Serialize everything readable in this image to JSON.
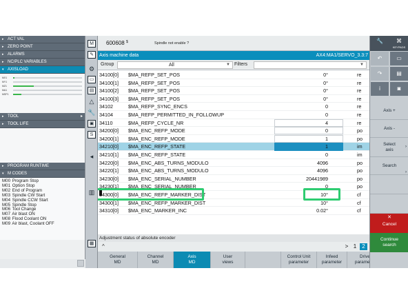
{
  "left_panel": {
    "sections": [
      {
        "label": "ACT VAL",
        "active": false
      },
      {
        "label": "ZERO POINT",
        "active": false
      },
      {
        "label": "ALARMS",
        "active": false
      },
      {
        "label": "NC/PLC VARIABLES",
        "active": false
      },
      {
        "label": "AXISLOAD",
        "active": true
      }
    ],
    "axisload_bars": [
      {
        "label": "MX1",
        "fraction": 0.02
      },
      {
        "label": "MY1",
        "fraction": 0.0
      },
      {
        "label": "MZ1",
        "fraction": 0.3
      },
      {
        "label": "MA1",
        "fraction": 0.0
      },
      {
        "label": "MSP1",
        "fraction": 0.12
      }
    ],
    "tool_sections": [
      {
        "label": "TOOL"
      },
      {
        "label": "TOOL LIFE"
      }
    ],
    "program_runtime": "PROGRAM RUNTIME",
    "m_codes_title": "M CODES",
    "m_codes": [
      {
        "code": "M00",
        "text": "Program Stop"
      },
      {
        "code": "M01",
        "text": "Option Stop"
      },
      {
        "code": "M02",
        "text": "End of Program"
      },
      {
        "code": "M03",
        "text": "Spindle CW Start"
      },
      {
        "code": "M04",
        "text": "Spindle CCW Start"
      },
      {
        "code": "M05",
        "text": "Spindle Stop"
      },
      {
        "code": "M06",
        "text": "Tool Change"
      },
      {
        "code": "M07",
        "text": "Air blast ON"
      },
      {
        "code": "M08",
        "text": "Flood Coolant ON"
      },
      {
        "code": "M09",
        "text": "Air blast, Coolant OFF"
      }
    ]
  },
  "header": {
    "channel": "600608",
    "channel_marker": "$",
    "alarm_text": "Spindle not enable ?"
  },
  "titlebar": {
    "title": "Axis machine data",
    "axis": "AX4:MA1/SERVO_3.3:7"
  },
  "filter": {
    "group_label": "Group",
    "group_value": "All",
    "filters_label": "Filters"
  },
  "table": {
    "rows": [
      {
        "num": "34100[0]",
        "name": "$MA_REFP_SET_POS",
        "value": "0°",
        "unit": "re"
      },
      {
        "num": "34100[1]",
        "name": "$MA_REFP_SET_POS",
        "value": "0°",
        "unit": "re"
      },
      {
        "num": "34100[2]",
        "name": "$MA_REFP_SET_POS",
        "value": "0°",
        "unit": "re"
      },
      {
        "num": "34100[3]",
        "name": "$MA_REFP_SET_POS",
        "value": "0°",
        "unit": "re"
      },
      {
        "num": "34102",
        "name": "$MA_REFP_SYNC_ENCS",
        "value": "0",
        "unit": "re"
      },
      {
        "num": "34104",
        "name": "$MA_REFP_PERMITTED_IN_FOLLOWUP",
        "value": "0",
        "unit": "re"
      },
      {
        "num": "34110",
        "name": "$MA_REFP_CYCLE_NR",
        "value": "4",
        "unit": "re"
      },
      {
        "num": "34200[0]",
        "name": "$MA_ENC_REFP_MODE",
        "value": "0",
        "unit": "po"
      },
      {
        "num": "34200[1]",
        "name": "$MA_ENC_REFP_MODE",
        "value": "1",
        "unit": "po"
      },
      {
        "num": "34210[0]",
        "name": "$MA_ENC_REFP_STATE",
        "value": "1",
        "unit": "im"
      },
      {
        "num": "34210[1]",
        "name": "$MA_ENC_REFP_STATE",
        "value": "0",
        "unit": "im"
      },
      {
        "num": "34220[0]",
        "name": "$MA_ENC_ABS_TURNS_MODULO",
        "value": "4096",
        "unit": "po"
      },
      {
        "num": "34220[1]",
        "name": "$MA_ENC_ABS_TURNS_MODULO",
        "value": "4096",
        "unit": "po"
      },
      {
        "num": "34230[0]",
        "name": "$MA_ENC_SERIAL_NUMBER",
        "value": "20441989",
        "unit": "po"
      },
      {
        "num": "34230[1]",
        "name": "$MA_ENC_SERIAL_NUMBER",
        "value": "0",
        "unit": "po"
      },
      {
        "num": "34300[0]",
        "name": "$MA_ENC_REFP_MARKER_DIST",
        "value": "10°",
        "unit": "cf"
      },
      {
        "num": "34300[1]",
        "name": "$MA_ENC_REFP_MARKER_DIST",
        "value": "10°",
        "unit": "cf"
      },
      {
        "num": "34310[0]",
        "name": "$MA_ENC_MARKER_INC",
        "value": "0.02°",
        "unit": "cf"
      }
    ],
    "selected_index": 9
  },
  "description": "Adjustment status of absolute encoder",
  "pager": {
    "up": "^",
    "gt": ">",
    "page1": "1",
    "page2": "2"
  },
  "bottom_softkeys": [
    {
      "label": "General\nMD",
      "active": false
    },
    {
      "label": "Channel\nMD",
      "active": false
    },
    {
      "label": "Axis\nMD",
      "active": true
    },
    {
      "label": "User\nviews",
      "active": false
    },
    {
      "label": "",
      "active": false
    },
    {
      "label": "Control Unit\nparameter",
      "active": false
    },
    {
      "label": "Infeed\nparameter",
      "active": false
    },
    {
      "label": "Drive\nparameter",
      "active": false
    }
  ],
  "right_softkeys": {
    "top_left_icon": "wrench-icon",
    "top_right_label": "KEYPADS",
    "axis_plus": "Axis +",
    "axis_minus": "Axis -",
    "select_axis": "Select\naxis",
    "search": "Search",
    "cancel": "Cancel",
    "continue_search": "Continue\nsearch"
  },
  "colors": {
    "accent": "#0a8ebc",
    "selected_row": "#9fd3e6",
    "highlight": "#2ecc71",
    "cancel": "#c01c1c",
    "continue": "#2f8a3c"
  }
}
